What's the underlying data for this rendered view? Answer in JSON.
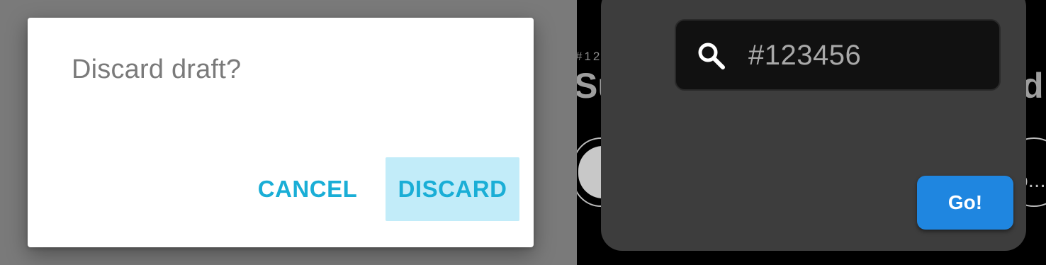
{
  "dialog": {
    "title": "Discard draft?",
    "cancel_label": "CANCEL",
    "discard_label": "DISCARD",
    "accent_color": "#1aaed6"
  },
  "background": {
    "hash_text": "#12",
    "title_left": "Su",
    "title_right": "d",
    "chip_right_text": "o..."
  },
  "search": {
    "icon": "search-icon",
    "value": "#123456"
  },
  "go_button": {
    "label": "Go!",
    "color": "#1f86e0"
  }
}
